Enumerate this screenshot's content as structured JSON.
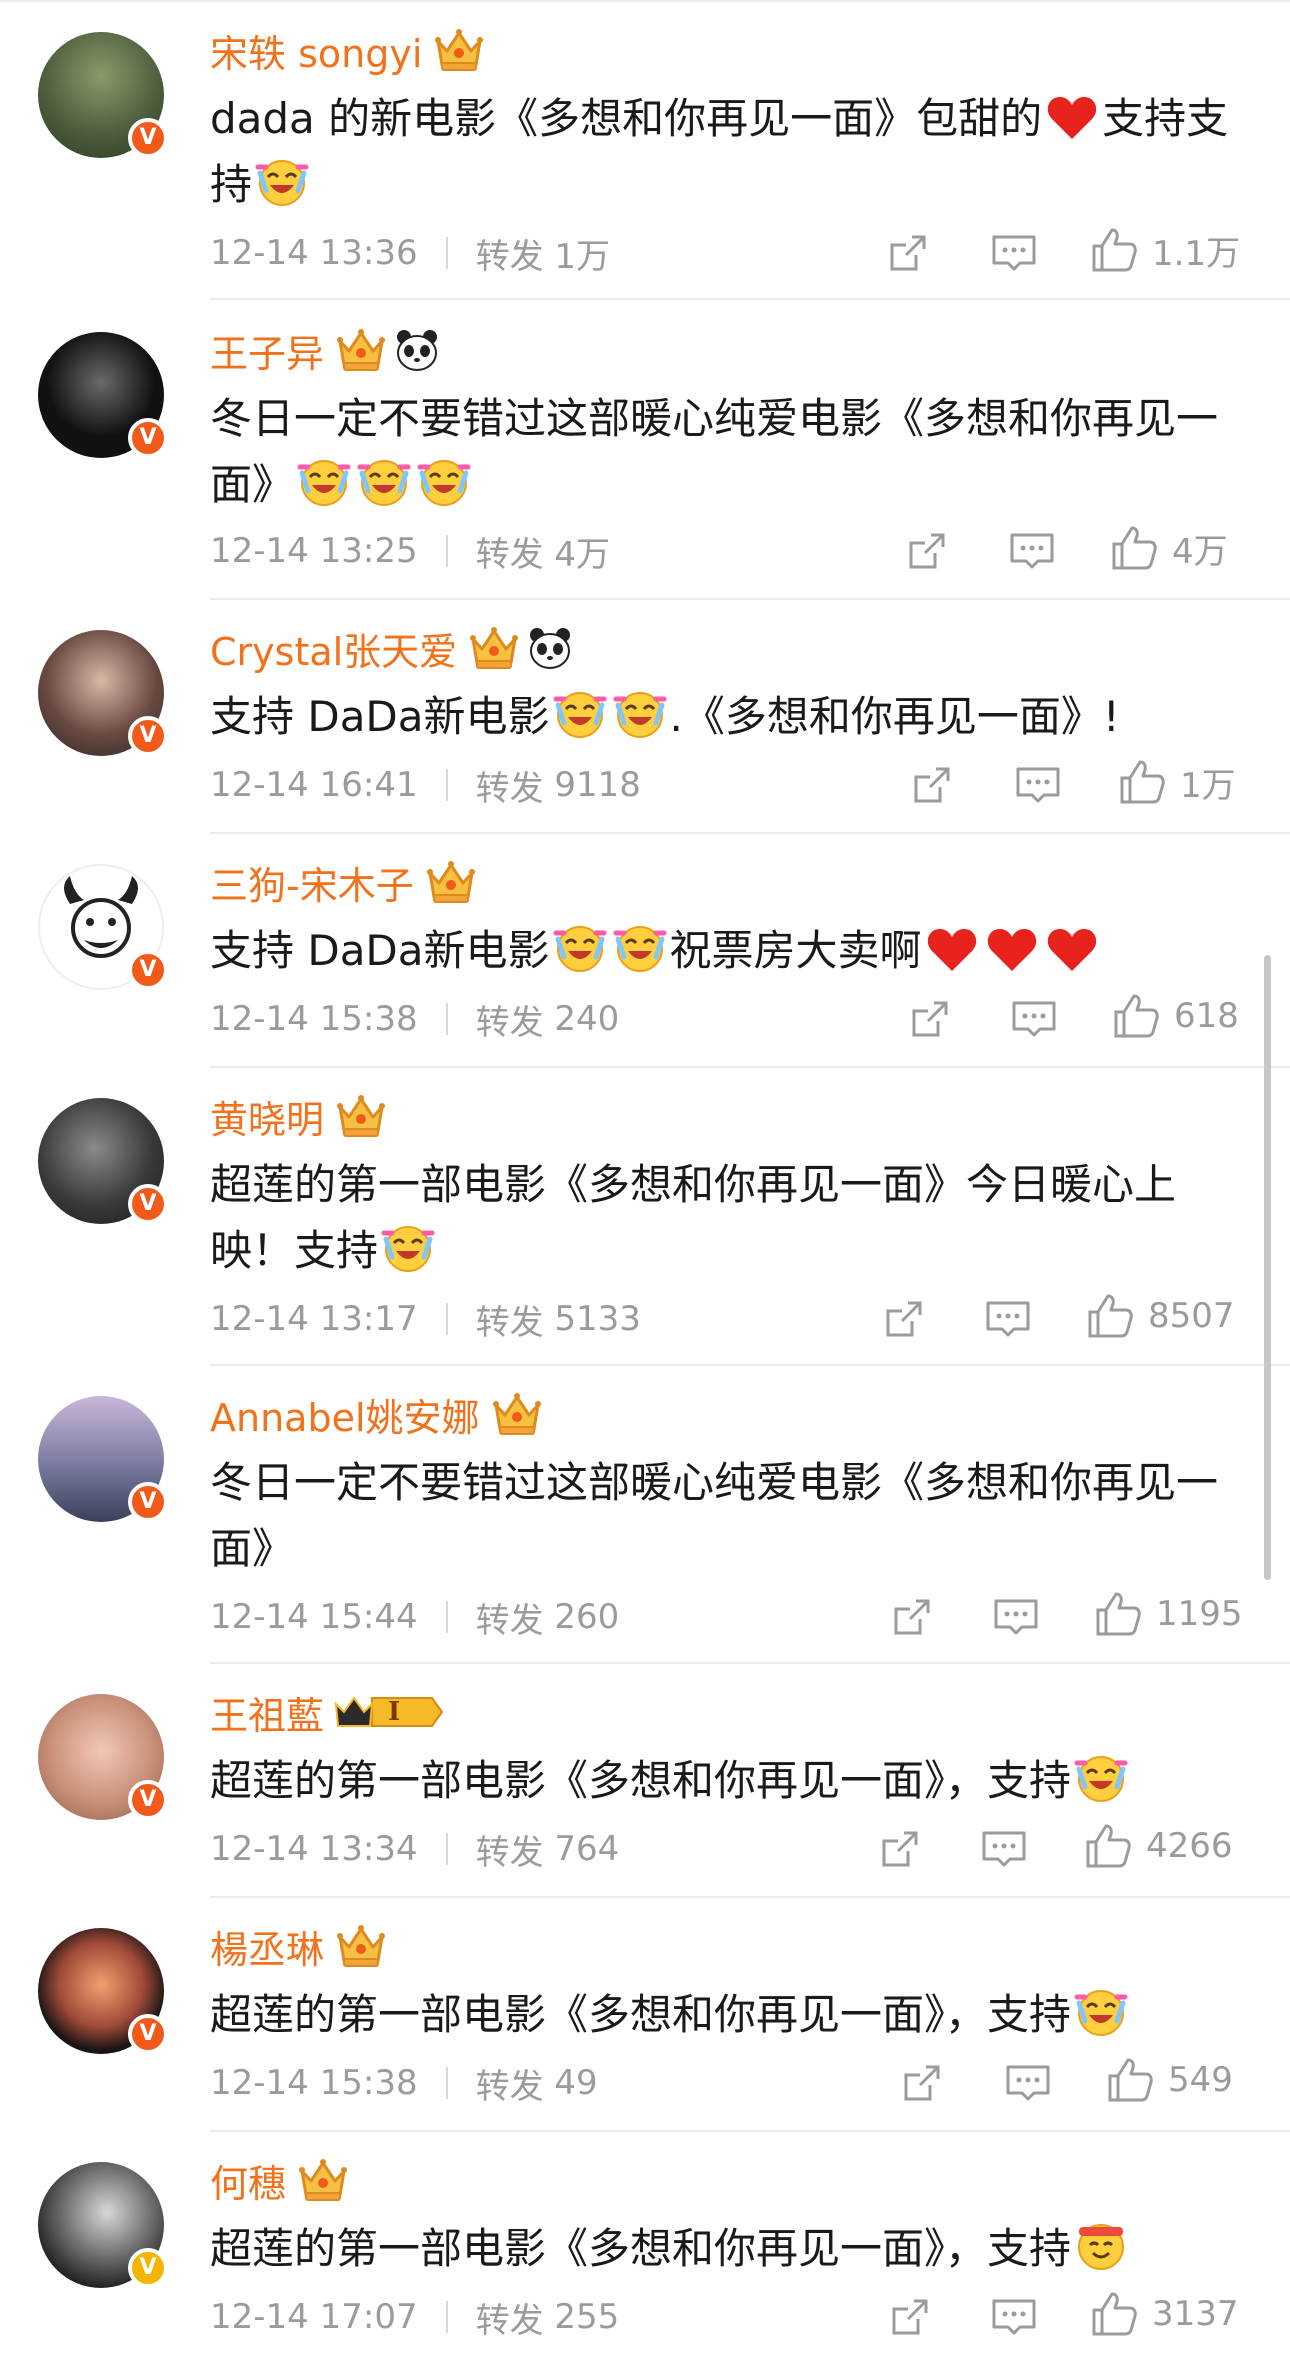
{
  "comments": [
    {
      "name": "宋轶 songyi",
      "text": "dada 的新电影《多想和你再见一面》包甜的",
      "text_after": "支持支持",
      "time": "12-14 13:36",
      "repost_label": "转发",
      "reposts": "1万",
      "likes": "1.1万"
    },
    {
      "name": "王子异",
      "text": "冬日一定不要错过这部暖心纯爱电影《多想和你再见一面》",
      "time": "12-14 13:25",
      "repost_label": "转发",
      "reposts": "4万",
      "likes": "4万"
    },
    {
      "name": "Crystal张天爱",
      "text": "支持 DaDa新电影",
      "text_after": ".《多想和你再见一面》!",
      "time": "12-14 16:41",
      "repost_label": "转发",
      "reposts": "9118",
      "likes": "1万"
    },
    {
      "name": "三狗-宋木子",
      "text": "支持 DaDa新电影",
      "text_after": "祝票房大卖啊",
      "time": "12-14 15:38",
      "repost_label": "转发",
      "reposts": "240",
      "likes": "618"
    },
    {
      "name": "黄晓明",
      "text": "超莲的第一部电影《多想和你再见一面》今日暖心上映！支持",
      "time": "12-14 13:17",
      "repost_label": "转发",
      "reposts": "5133",
      "likes": "8507"
    },
    {
      "name": "Annabel姚安娜",
      "text": "冬日一定不要错过这部暖心纯爱电影《多想和你再见一面》",
      "time": "12-14 15:44",
      "repost_label": "转发",
      "reposts": "260",
      "likes": "1195"
    },
    {
      "name": "王祖藍",
      "vip_level": "I",
      "text": "超莲的第一部电影《多想和你再见一面》，支持",
      "time": "12-14 13:34",
      "repost_label": "转发",
      "reposts": "764",
      "likes": "4266"
    },
    {
      "name": "楊丞琳",
      "text": "超莲的第一部电影《多想和你再见一面》，支持",
      "time": "12-14 15:38",
      "repost_label": "转发",
      "reposts": "49",
      "likes": "549"
    },
    {
      "name": "何穗",
      "text": "超莲的第一部电影《多想和你再见一面》，支持",
      "time": "12-14 17:07",
      "repost_label": "转发",
      "reposts": "255",
      "likes": "3137"
    }
  ],
  "badge_letter": "V",
  "colors": {
    "name": "#f2721c",
    "meta": "#9b9b9b",
    "badge": "#f25a1a",
    "badge_gold": "#f4b400"
  }
}
